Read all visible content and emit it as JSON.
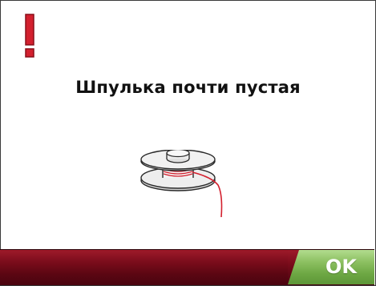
{
  "dialog": {
    "message": "Шпулька почти пустая",
    "ok_label": "OK"
  },
  "icons": {
    "warning": "exclamation-icon",
    "bobbin": "bobbin-icon"
  },
  "colors": {
    "accent_red": "#d3202e",
    "footer_bar": "#6a0817",
    "ok_green": "#7cb452",
    "text": "#111111",
    "thread": "#d3202e"
  }
}
